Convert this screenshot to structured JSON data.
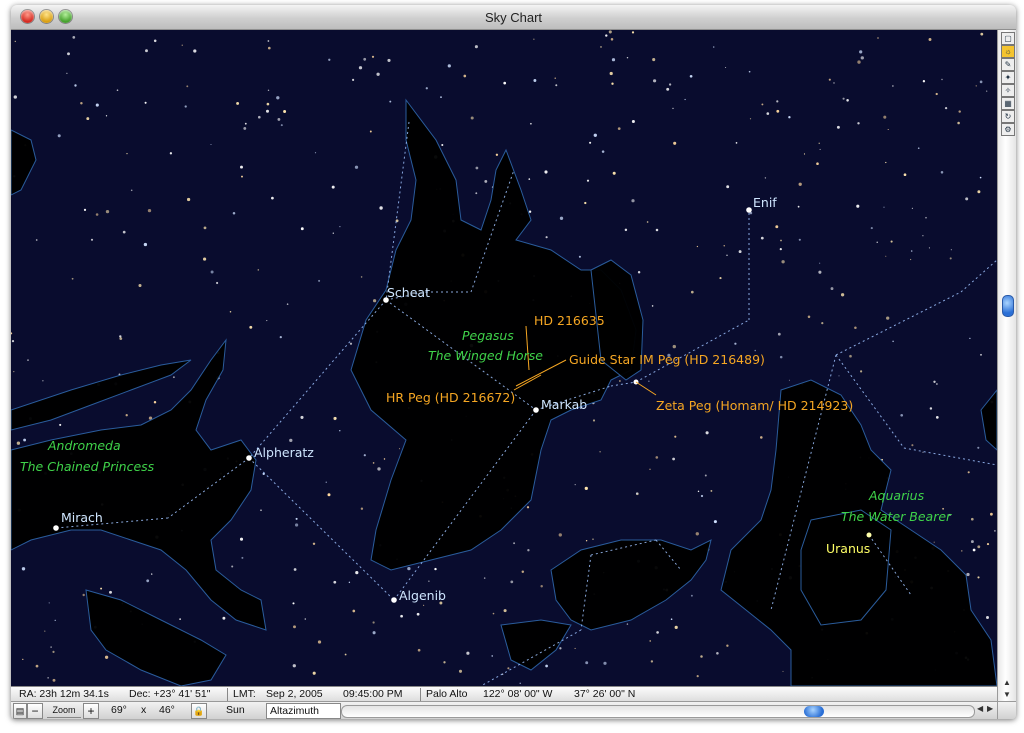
{
  "window": {
    "title": "Sky Chart"
  },
  "labels": {
    "stars": {
      "enif": "Enif",
      "scheat": "Scheat",
      "markab": "Markab",
      "alpheratz": "Alpheratz",
      "mirach": "Mirach",
      "algenib": "Algenib",
      "uranus": "Uranus"
    },
    "constellations": {
      "pegasus_name": "Pegasus",
      "pegasus_desc": "The Winged Horse",
      "andromeda_name": "Andromeda",
      "andromeda_desc": "The Chained Princess",
      "aquarius_name": "Aquarius",
      "aquarius_desc": "The Water Bearer"
    },
    "highlighted": {
      "hd216635": "HD 216635",
      "guide_star": "Guide Star IM Peg (HD 216489)",
      "hr_peg": "HR Peg (HD 216672)",
      "zeta_peg": "Zeta Peg  (Homam/ HD 214923)"
    }
  },
  "status": {
    "ra": "RA: 23h 12m 34.1s",
    "dec": "Dec:  +23° 41' 51\"",
    "lmt_label": "LMT:",
    "date": "Sep  2, 2005",
    "time": "09:45:00 PM",
    "location": "Palo Alto",
    "longitude": "122° 08' 00\" W",
    "latitude": "37° 26' 00\" N"
  },
  "controls": {
    "zoom_label": "Zoom",
    "minus": "−",
    "plus": "+",
    "fov_w": "69°",
    "times": "x",
    "fov_h": "46°",
    "lock_icon": "lock-icon",
    "center_object": "Sun",
    "projection": "Altazimuth"
  },
  "toolbar_icons": [
    "window-icon",
    "sun-icon",
    "pen-icon",
    "stars-icon",
    "filter-icon",
    "grid-icon",
    "rotate-icon",
    "settings-icon"
  ],
  "colors": {
    "sky": "#090c2e",
    "star_label": "#cfe6ff",
    "constellation_label": "#3fd24a",
    "highlight_label": "#f5a623",
    "planet_label": "#ffff66"
  }
}
